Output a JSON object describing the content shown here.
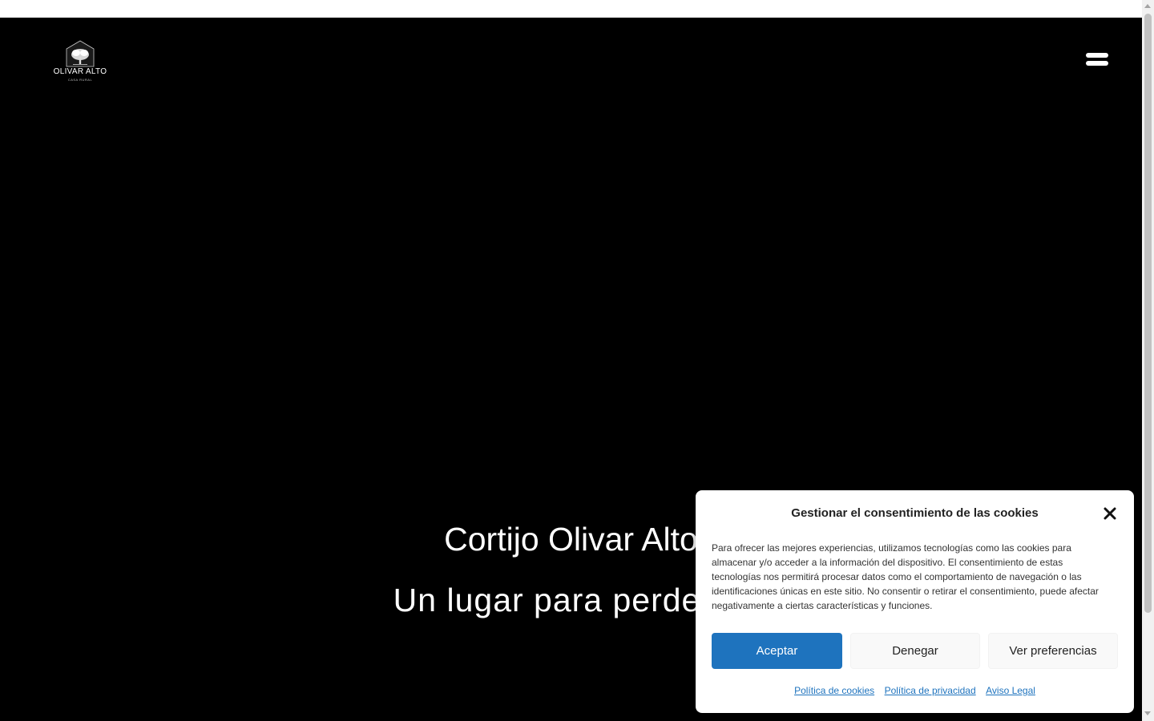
{
  "logo": {
    "name": "OLIVAR ALTO",
    "tagline": "CASA RURAL"
  },
  "hero": {
    "title": "Cortijo Olivar Alto",
    "subtitle": "Un lugar para perderse"
  },
  "cookie_banner": {
    "title": "Gestionar el consentimiento de las cookies",
    "message": "Para ofrecer las mejores experiencias, utilizamos tecnologías como las cookies para almacenar y/o acceder a la información del dispositivo. El consentimiento de estas tecnologías nos permitirá procesar datos como el comportamiento de navegación o las identificaciones únicas en este sitio. No consentir o retirar el consentimiento, puede afectar negativamente a ciertas características y funciones.",
    "accept_label": "Aceptar",
    "deny_label": "Denegar",
    "preferences_label": "Ver preferencias",
    "links": {
      "cookie_policy": "Política de cookies",
      "privacy_policy": "Política de privacidad",
      "legal_notice": "Aviso Legal"
    }
  },
  "icons": {
    "menu": "hamburger-menu-icon",
    "close": "close-icon",
    "logo": "olive-tree-logo-icon"
  },
  "colors": {
    "hero_background": "#000000",
    "accent": "#1e73be",
    "banner_background": "#ffffff"
  }
}
